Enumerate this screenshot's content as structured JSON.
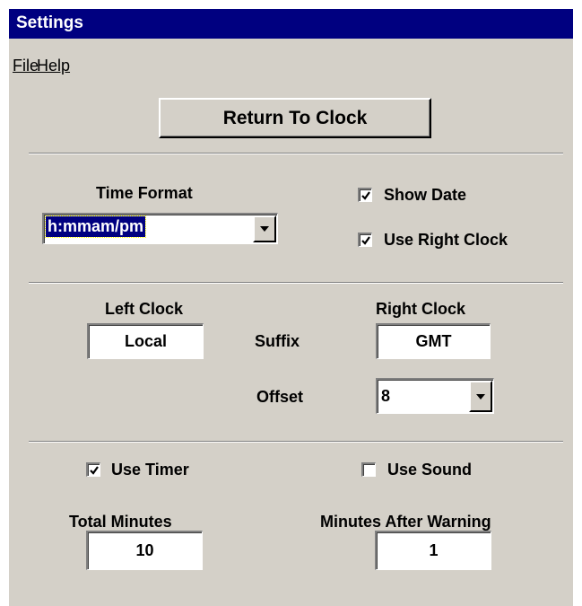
{
  "window": {
    "title": "Settings"
  },
  "menu": {
    "file": "File",
    "help": "Help"
  },
  "return_button": {
    "label": "Return To Clock"
  },
  "time_format": {
    "label": "Time Format",
    "value": "h:mmam/pm"
  },
  "show_date": {
    "label": "Show Date",
    "checked": true
  },
  "use_right_clock": {
    "label": "Use Right Clock",
    "checked": true
  },
  "left_clock": {
    "label": "Left Clock",
    "suffix_value": "Local"
  },
  "right_clock": {
    "label": "Right Clock",
    "suffix_value": "GMT",
    "offset_value": "8"
  },
  "suffix_label": "Suffix",
  "offset_label": "Offset",
  "use_timer": {
    "label": "Use Timer",
    "checked": true
  },
  "use_sound": {
    "label": "Use Sound",
    "checked": false
  },
  "total_minutes": {
    "label": "Total Minutes",
    "value": "10"
  },
  "minutes_after_warning": {
    "label": "Minutes After Warning",
    "value": "1"
  },
  "colors": {
    "titlebar": "#000080",
    "face": "#d4d0c8",
    "selection": "#000080"
  }
}
